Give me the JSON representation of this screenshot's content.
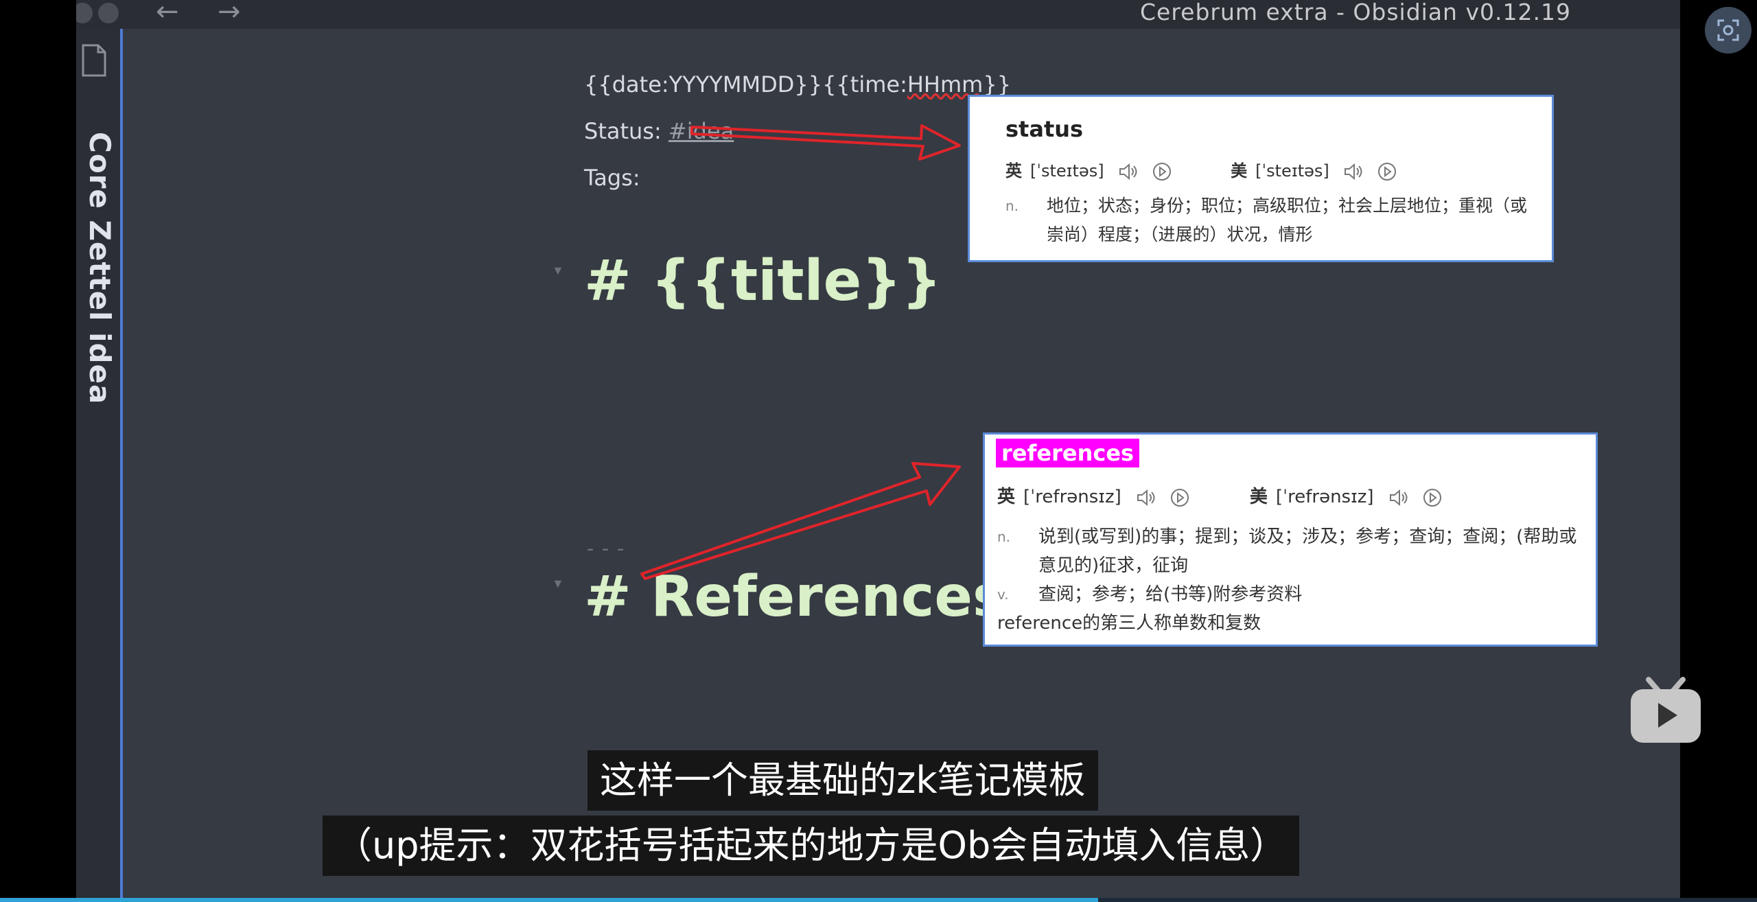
{
  "window": {
    "title": "Cerebrum extra - Obsidian v0.12.19"
  },
  "sidebar": {
    "title": "Core Zettel idea",
    "icon": "file-icon"
  },
  "editor": {
    "date_line": "{{date:YYYYMMDD}}{{time:HHmm}}",
    "date_prefix": "{{date:YYYYMMDD}}{{time:",
    "date_spell": "HHmm",
    "date_suffix": "}}",
    "status_label": "Status: ",
    "status_tag": "#idea",
    "tags_label": "Tags:",
    "heading_title": "# {{title}}",
    "hr": "---",
    "heading_refs": "# References"
  },
  "popup_status": {
    "word": "status",
    "uk_label": "英",
    "uk_phon": "[ˈsteɪtəs]",
    "us_label": "美",
    "us_phon": "[ˈsteɪtəs]",
    "defs": [
      {
        "pos": "n.",
        "text": "地位；状态；身份；职位；高级职位；社会上层地位；重视（或崇尚）程度；（进展的）状况，情形"
      }
    ]
  },
  "popup_refs": {
    "word": "references",
    "uk_label": "英",
    "uk_phon": "[ˈrefrənsɪz]",
    "us_label": "美",
    "us_phon": "[ˈrefrənsɪz]",
    "defs": [
      {
        "pos": "n.",
        "text": "说到(或写到)的事；提到；谈及；涉及；参考；查询；查阅；(帮助或意见的)征求，征询"
      },
      {
        "pos": "v.",
        "text": "查阅；参考；给(书等)附参考资料"
      }
    ],
    "note": "reference的第三人称单数和复数"
  },
  "subtitles": {
    "line1": "这样一个最基础的zk笔记模板",
    "line2": "（up提示：双花括号括起来的地方是Ob会自动填入信息）"
  },
  "colors": {
    "accent": "#4f7bd3",
    "heading": "#d9f0c8",
    "highlight": "#ff00ff",
    "arrow": "#e0242a"
  },
  "video": {
    "progress": 0.625
  }
}
